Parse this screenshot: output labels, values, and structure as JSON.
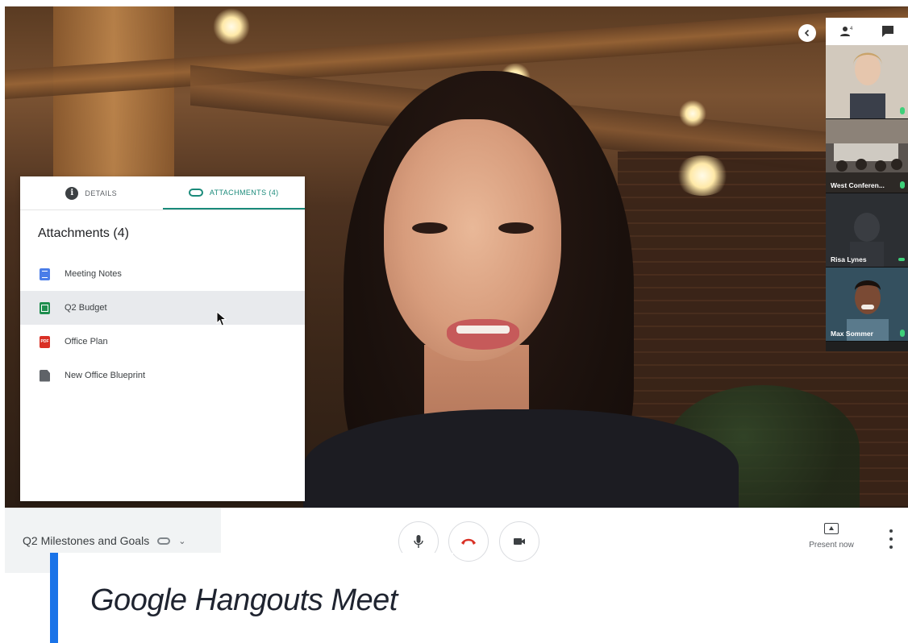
{
  "video": {
    "participants": [
      {
        "name": ""
      },
      {
        "name": "West Conferen..."
      },
      {
        "name": "Risa Lynes"
      },
      {
        "name": "Max Sommer"
      }
    ]
  },
  "panel": {
    "tabs": [
      {
        "label": "DETAILS",
        "active": false
      },
      {
        "label": "ATTACHMENTS (4)",
        "active": true
      }
    ],
    "title": "Attachments (4)",
    "attachments": [
      {
        "label": "Meeting Notes",
        "icon": "doc-icon",
        "color": "#4a7de8"
      },
      {
        "label": "Q2 Budget",
        "icon": "sheet-icon",
        "color": "#1e8e4e"
      },
      {
        "label": "Office Plan",
        "icon": "pdf-icon",
        "color": "#d93025"
      },
      {
        "label": "New Office Blueprint",
        "icon": "file-icon",
        "color": "#5f6368"
      }
    ],
    "pdf_badge": "PDF"
  },
  "toolbar": {
    "meeting_title": "Q2 Milestones and Goals",
    "present_label": "Present now"
  },
  "caption": {
    "text": "Google Hangouts Meet",
    "accent": "#1a73e8"
  },
  "colors": {
    "accent_teal": "#1a8a7a",
    "hangup_red": "#d93025"
  }
}
